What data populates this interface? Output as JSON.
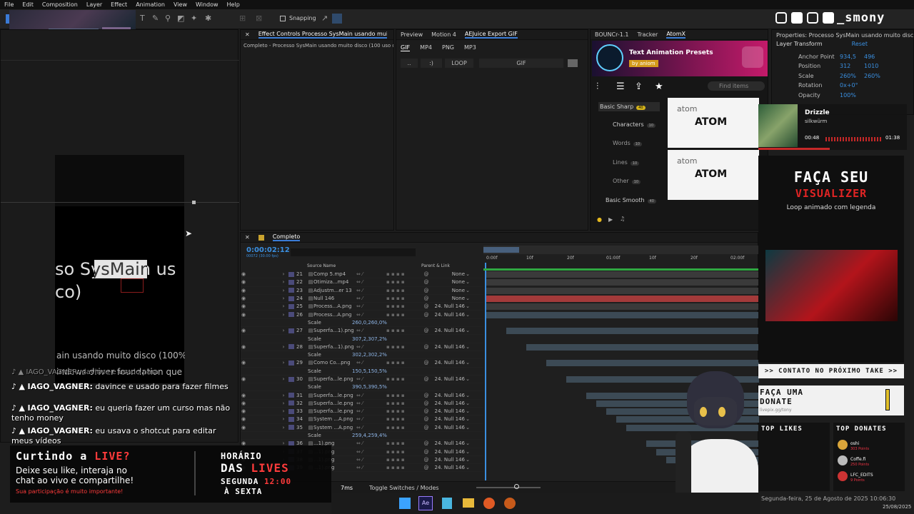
{
  "menu": [
    "File",
    "Edit",
    "Composition",
    "Layer",
    "Effect",
    "Animation",
    "View",
    "Window",
    "Help"
  ],
  "toolbar": {
    "snapping": "Snapping"
  },
  "comp_text": {
    "l1": "so SysMain us",
    "l2": "co)",
    "l3": "ain usando muito disco (100%",
    "l4": "indows driver foundation que"
  },
  "effect_controls": {
    "tab": "Effect Controls Processo SysMain usando muito d",
    "line": "Completo - Processo SysMain usando muito disco (100 uso de di"
  },
  "preview_tabs": [
    "Preview",
    "Motion 4",
    "AEJuice Export GIF"
  ],
  "aejuice": {
    "formats": [
      "GIF",
      "MP4",
      "PNG",
      "MP3"
    ],
    "btns": [
      "..",
      ":)",
      "LOOP",
      "GIF"
    ]
  },
  "atomx": {
    "tabs": [
      "BOUNCr-1.1",
      "Tracker",
      "AtomX"
    ],
    "title": "Text Animation Presets",
    "by": "by",
    "brand": "aniom",
    "search": "Find items",
    "cats": [
      {
        "l": "Basic Sharp",
        "n": "40"
      },
      {
        "l": "Characters",
        "n": "10"
      },
      {
        "l": "Words",
        "n": "10"
      },
      {
        "l": "Lines",
        "n": "10"
      },
      {
        "l": "Other",
        "n": "10"
      },
      {
        "l": "Basic Smooth",
        "n": "40"
      }
    ],
    "card_small": "atom",
    "card_big": "ATOM"
  },
  "properties": {
    "title": "Properties: Processo SysMain usando muito disco (",
    "section": "Layer Transform",
    "reset": "Reset",
    "rows": [
      {
        "l": "Anchor Point",
        "a": "934,5",
        "b": "496"
      },
      {
        "l": "Position",
        "a": "312",
        "b": "1010"
      },
      {
        "l": "Scale",
        "a": "260%",
        "b": "260%"
      },
      {
        "l": "Rotation",
        "a": "0x+0°",
        "b": ""
      },
      {
        "l": "Opacity",
        "a": "100%",
        "b": ""
      }
    ]
  },
  "timeline": {
    "tab": "Completo",
    "time": "0:00:02:12",
    "fps": "00072 (30.00 fps)",
    "col_source": "Source Name",
    "col_parent": "Parent & Link",
    "ruler": [
      "0:00f",
      "10f",
      "20f",
      "01:00f",
      "10f",
      "20f",
      "02:00f"
    ],
    "footer_time": "7ms",
    "footer": "Toggle Switches / Modes",
    "rows": [
      {
        "t": "l",
        "n": "21",
        "s": "Comp 5.mp4",
        "p": "None"
      },
      {
        "t": "l",
        "n": "22",
        "s": "Otimiza...mp4",
        "p": "None"
      },
      {
        "t": "l",
        "n": "23",
        "s": "Adjustm...er 13",
        "p": "None"
      },
      {
        "t": "l",
        "n": "24",
        "s": "Null 146",
        "p": "None"
      },
      {
        "t": "l",
        "n": "25",
        "s": "Process...A.png",
        "p": "24. Null 146"
      },
      {
        "t": "l",
        "n": "26",
        "s": "Process...A.png",
        "p": "24. Null 146"
      },
      {
        "t": "p",
        "s": "Scale",
        "v": "260,0,260,0%"
      },
      {
        "t": "l",
        "n": "27",
        "s": "Superfa...1).png",
        "p": "24. Null 146"
      },
      {
        "t": "p",
        "s": "Scale",
        "v": "307,2,307,2%"
      },
      {
        "t": "l",
        "n": "28",
        "s": "Superfa...1).png",
        "p": "24. Null 146"
      },
      {
        "t": "p",
        "s": "Scale",
        "v": "302,2,302,2%"
      },
      {
        "t": "l",
        "n": "29",
        "s": "Como Co...png",
        "p": "24. Null 146"
      },
      {
        "t": "p",
        "s": "Scale",
        "v": "150,5,150,5%"
      },
      {
        "t": "l",
        "n": "30",
        "s": "Superfa...le.png",
        "p": "24. Null 146"
      },
      {
        "t": "p",
        "s": "Scale",
        "v": "390,5,390,5%"
      },
      {
        "t": "l",
        "n": "31",
        "s": "Superfa...le.png",
        "p": "24. Null 146"
      },
      {
        "t": "l",
        "n": "32",
        "s": "Superfa...le.png",
        "p": "24. Null 146"
      },
      {
        "t": "l",
        "n": "33",
        "s": "Superfa...le.png",
        "p": "24. Null 146"
      },
      {
        "t": "l",
        "n": "34",
        "s": "System ...A.png",
        "p": "24. Null 146"
      },
      {
        "t": "l",
        "n": "35",
        "s": "System ...A.png",
        "p": "24. Null 146"
      },
      {
        "t": "p",
        "s": "Scale",
        "v": "259,4,259,4%"
      },
      {
        "t": "l",
        "n": "36",
        "s": "...1).png",
        "p": "24. Null 146"
      },
      {
        "t": "l",
        "n": "37",
        "s": "...1).png",
        "p": "24. Null 146"
      },
      {
        "t": "l",
        "n": "38",
        "s": "...1).png",
        "p": "24. Null 146"
      },
      {
        "t": "l",
        "n": "39",
        "s": "...1).png",
        "p": "24. Null 146"
      }
    ]
  },
  "chat": [
    {
      "u": "IAGO_VAGNER:",
      "m": "davince e usado para fazer filmes"
    },
    {
      "u": "IAGO_VAGNER:",
      "m": "eu queria fazer um curso mas não tenho money"
    },
    {
      "u": "IAGO_VAGNER:",
      "m": "eu usava o shotcut para editar meus vídeos"
    }
  ],
  "chat_ghost": "IAGO_VAGNER: davince e usado para",
  "banner": {
    "a": "Curtindo a",
    "b": "LIVE?",
    "c": "Deixe seu like, interaja no",
    "d": "chat ao vivo e compartilhe!",
    "e": "Sua participação é muito importante!",
    "h1": "HORÁRIO",
    "h2": "DAS",
    "h3": "LIVES",
    "h4": "SEGUNDA",
    "h5": "12:00",
    "h6": "À SEXTA"
  },
  "music": {
    "title": "Drizzle",
    "artist": "silkwürm",
    "cur": "00:48",
    "end": "01:38"
  },
  "social": "_smony",
  "viz": {
    "a": "FAÇA SEU",
    "b": "VISUALIZER",
    "c": "Loop animado com legenda"
  },
  "contact": ">> CONTATO NO PRÓXIMO TAKE >>",
  "donate": {
    "a": "FAÇA UMA",
    "b": "DONATE",
    "c": "livepix.gg/tony"
  },
  "likes": {
    "a": "TOP LIKES",
    "b": "TOP DONATES",
    "donors": [
      {
        "n": "oshi",
        "p": "303 Points"
      },
      {
        "n": "Coffe.fi",
        "p": "250 Points"
      },
      {
        "n": "LFC_EDITS",
        "p": "9 Points"
      }
    ]
  },
  "taskbar": {
    "date": "Segunda-feira, 25 de Agosto de 2025 10:06:30",
    "short": "25/08/2025"
  },
  "colors": {
    "accent": "#3a8fe0",
    "live": "#ff3b3b",
    "atom_pink": "#c41a6a"
  }
}
